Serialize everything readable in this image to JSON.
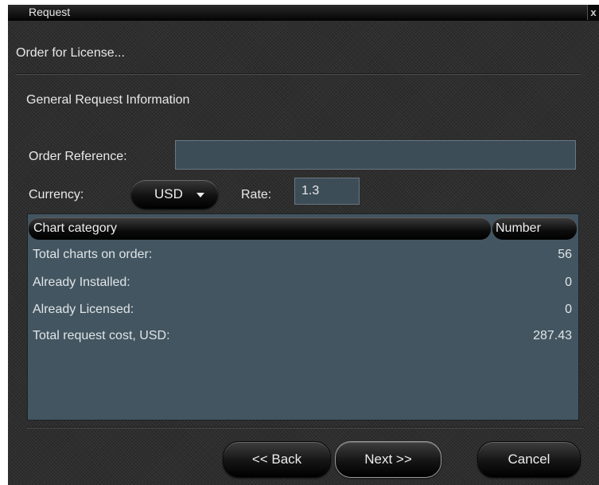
{
  "window": {
    "title": "Request",
    "close_glyph": "x"
  },
  "header": {
    "subtitle": "Order for License..."
  },
  "section": {
    "title": "General Request Information"
  },
  "form": {
    "order_reference_label": "Order Reference:",
    "order_reference_value": "",
    "currency_label": "Currency:",
    "currency_value": "USD",
    "rate_label": "Rate:",
    "rate_value": "1.3"
  },
  "table": {
    "columns": [
      "Chart category",
      "Number"
    ],
    "rows": [
      {
        "category": "Total charts on order:",
        "number": "56"
      },
      {
        "category": "Already Installed:",
        "number": "0"
      },
      {
        "category": "Already Licensed:",
        "number": "0"
      },
      {
        "category": "Total request cost, USD:",
        "number": "287.43"
      }
    ]
  },
  "buttons": {
    "back": "<< Back",
    "next": "Next >>",
    "cancel": "Cancel"
  },
  "colors": {
    "panel_background": "#2e2e2e",
    "table_background": "#435560",
    "input_background": "#3d4d58",
    "text": "#e8e8e8"
  }
}
